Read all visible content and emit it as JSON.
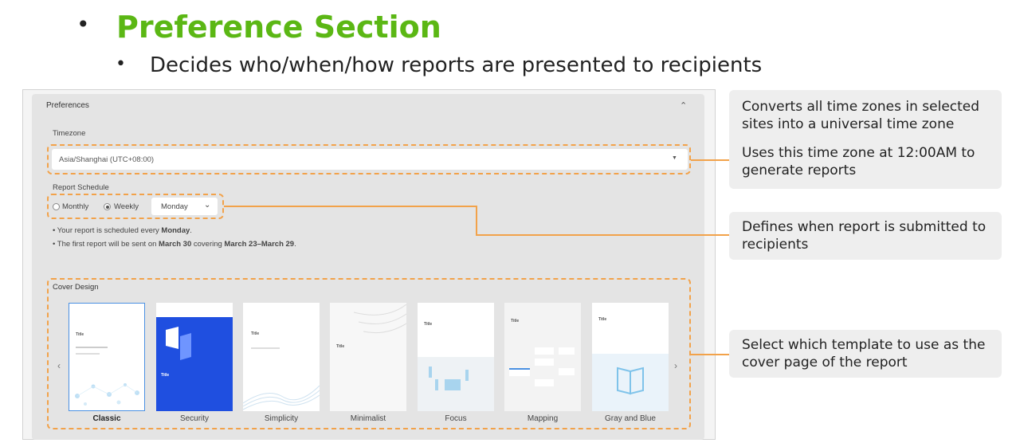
{
  "slide": {
    "title": "Preference Section",
    "subtitle": "Decides who/when/how reports are presented to recipients"
  },
  "preferences": {
    "panel_title": "Preferences",
    "timezone_label": "Timezone",
    "timezone_value": "Asia/Shanghai (UTC+08:00)",
    "report_schedule_label": "Report Schedule",
    "monthly_label": "Monthly",
    "weekly_label": "Weekly",
    "selected_frequency": "Weekly",
    "day_value": "Monday",
    "note_1_prefix": "• Your report is scheduled every ",
    "note_1_day": "Monday",
    "note_1_suffix": ".",
    "note_2_prefix": "• The first report will be sent on ",
    "note_2_date": "March 30",
    "note_2_mid": " covering ",
    "note_2_range": "March 23–March 29",
    "note_2_suffix": ".",
    "cover_design_label": "Cover Design",
    "templates": [
      {
        "name": "Classic",
        "selected": true
      },
      {
        "name": "Security",
        "selected": false
      },
      {
        "name": "Simplicity",
        "selected": false
      },
      {
        "name": "Minimalist",
        "selected": false
      },
      {
        "name": "Focus",
        "selected": false
      },
      {
        "name": "Mapping",
        "selected": false
      },
      {
        "name": "Gray and Blue",
        "selected": false
      }
    ],
    "thumb_title": "Title"
  },
  "callouts": {
    "timezone_line1": "Converts all time zones in selected sites into a universal time zone",
    "timezone_line2": "Uses this time zone at 12:00AM to generate reports",
    "schedule": "Defines when report is submitted to recipients",
    "cover": "Select which template to use as the cover page of the report"
  },
  "colors": {
    "title_green": "#5bb714",
    "highlight_orange": "#f2a24a",
    "security_blue": "#1f4fe0",
    "selection_blue": "#4a90e2"
  }
}
